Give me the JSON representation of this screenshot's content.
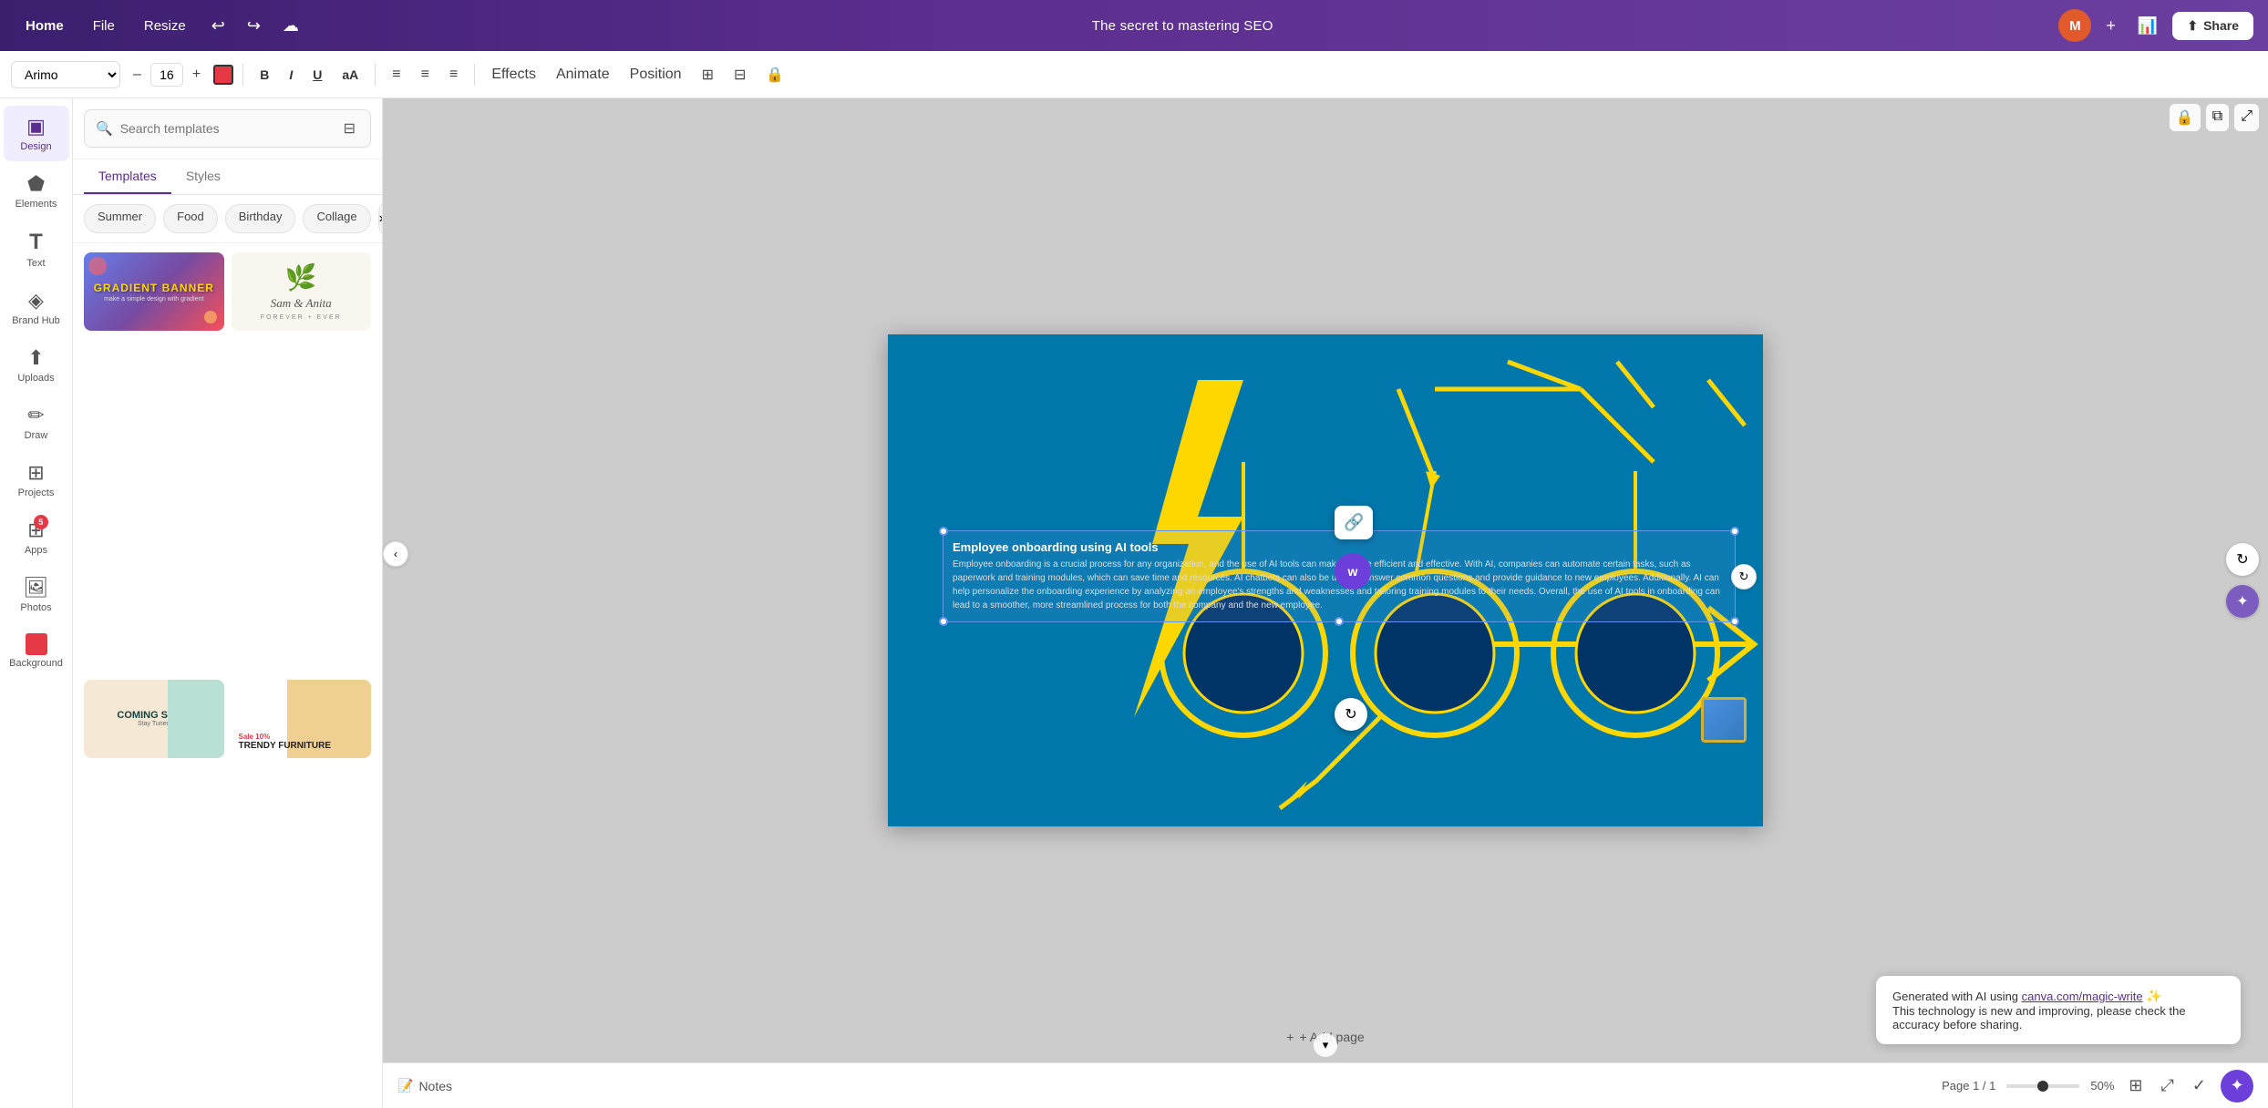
{
  "topnav": {
    "home_label": "Home",
    "file_label": "File",
    "resize_label": "Resize",
    "undo_icon": "↩",
    "redo_icon": "↪",
    "cloud_icon": "☁",
    "doc_title": "The secret to mastering SEO",
    "avatar_initials": "M",
    "plus_icon": "+",
    "analytics_icon": "📊",
    "share_icon": "⬆",
    "share_label": "Share"
  },
  "toolbar": {
    "font_family": "Arimo",
    "font_size": "16",
    "decrease_icon": "–",
    "increase_icon": "+",
    "color_hex": "#e63946",
    "bold_label": "B",
    "italic_label": "I",
    "underline_label": "U",
    "case_label": "aA",
    "align_left_icon": "≡",
    "align_center_icon": "≡",
    "align_right_icon": "≡",
    "effects_label": "Effects",
    "animate_label": "Animate",
    "position_label": "Position",
    "grid_icon": "⊞",
    "filter_icon": "⊟",
    "lock_icon": "🔒"
  },
  "sidebar": {
    "items": [
      {
        "id": "design",
        "label": "Design",
        "icon": "▣",
        "active": true
      },
      {
        "id": "elements",
        "label": "Elements",
        "icon": "⬟",
        "active": false
      },
      {
        "id": "text",
        "label": "Text",
        "icon": "T",
        "active": false
      },
      {
        "id": "brand-hub",
        "label": "Brand Hub",
        "icon": "◈",
        "active": false
      },
      {
        "id": "uploads",
        "label": "Uploads",
        "icon": "⬆",
        "active": false
      },
      {
        "id": "draw",
        "label": "Draw",
        "icon": "✏",
        "active": false
      },
      {
        "id": "projects",
        "label": "Projects",
        "icon": "⊞",
        "active": false
      },
      {
        "id": "apps",
        "label": "Apps",
        "icon": "⊞",
        "active": false,
        "badge": "5"
      },
      {
        "id": "photos",
        "label": "Photos",
        "icon": "🖼",
        "active": false
      },
      {
        "id": "background",
        "label": "Background",
        "icon": "⬜",
        "active": false
      }
    ]
  },
  "panel": {
    "search_placeholder": "Search templates",
    "tabs": [
      {
        "id": "templates",
        "label": "Templates",
        "active": true
      },
      {
        "id": "styles",
        "label": "Styles",
        "active": false
      }
    ],
    "chips": [
      {
        "label": "Summer"
      },
      {
        "label": "Food"
      },
      {
        "label": "Birthday"
      },
      {
        "label": "Collage"
      },
      {
        "label": "More",
        "is_more": true
      }
    ],
    "templates": [
      {
        "id": "gradient-banner",
        "type": "gradient",
        "title": "GRADIENT BANNER",
        "subtitle": "make a simple design with gradient"
      },
      {
        "id": "wedding",
        "type": "wedding",
        "name": "Sam & Anita",
        "subtitle": "FOREVER + EVER"
      },
      {
        "id": "coming-soon",
        "type": "coming",
        "title": "COMING SOON",
        "subtitle": "Stay Tuned"
      },
      {
        "id": "furniture",
        "type": "furniture",
        "badge": "Sale 10%",
        "title": "TRENDY FURNITURE"
      }
    ]
  },
  "canvas": {
    "bg_color": "#0077aa",
    "text_title": "Employee onboarding using AI tools",
    "text_body": "Employee onboarding is a crucial process for any organization, and the use of AI tools can make it more efficient and effective. With AI, companies can automate certain tasks, such as paperwork and training modules, which can save time and resources. AI chatbots can also be used to answer common questions and provide guidance to new employees. Additionally. AI can help personalize the onboarding experience by analyzing an employee's strengths and weaknesses and tailoring training modules to their needs. Overall, the use of AI tools in onboarding can lead to a smoother, more streamlined process for both the company and the new employee.",
    "ai_notice": "Generated with AI using",
    "ai_link": "canva.com/magic-write",
    "ai_disclaimer": "This technology is new and improving, please check the accuracy before sharing.",
    "add_page_label": "+ Add page",
    "lock_icon": "🔒",
    "copy_icon": "⧉",
    "expand_icon": "⬆"
  },
  "bottombar": {
    "notes_icon": "📝",
    "notes_label": "Notes",
    "page_label": "Page 1 / 1",
    "zoom_label": "50%",
    "grid_view_icon": "⊞",
    "expand_icon": "⤢",
    "check_icon": "✓",
    "chat_icon": "💬"
  }
}
